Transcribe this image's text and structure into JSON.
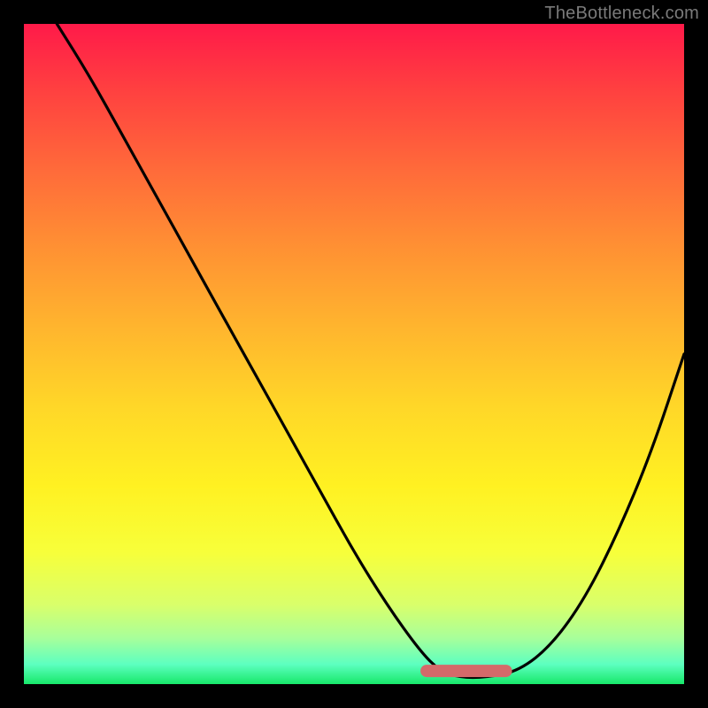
{
  "attribution": "TheBottleneck.com",
  "colors": {
    "page_bg": "#000000",
    "gradient_top": "#ff1a49",
    "gradient_bottom": "#17e86a",
    "curve": "#000000",
    "marker": "#d46a6a"
  },
  "chart_data": {
    "type": "line",
    "title": "",
    "xlabel": "",
    "ylabel": "",
    "xlim": [
      0,
      100
    ],
    "ylim": [
      0,
      100
    ],
    "grid": false,
    "legend": false,
    "series": [
      {
        "name": "bottleneck-curve",
        "x": [
          5,
          10,
          15,
          20,
          25,
          30,
          35,
          40,
          45,
          50,
          55,
          60,
          63,
          66,
          70,
          75,
          80,
          85,
          90,
          95,
          100
        ],
        "y": [
          100,
          92,
          83,
          74,
          65,
          56,
          47,
          38,
          29,
          20,
          12,
          5,
          2,
          1,
          1,
          2,
          6,
          13,
          23,
          35,
          50
        ]
      }
    ],
    "marker_segment": {
      "x_start": 61,
      "x_end": 73,
      "y": 2
    }
  }
}
